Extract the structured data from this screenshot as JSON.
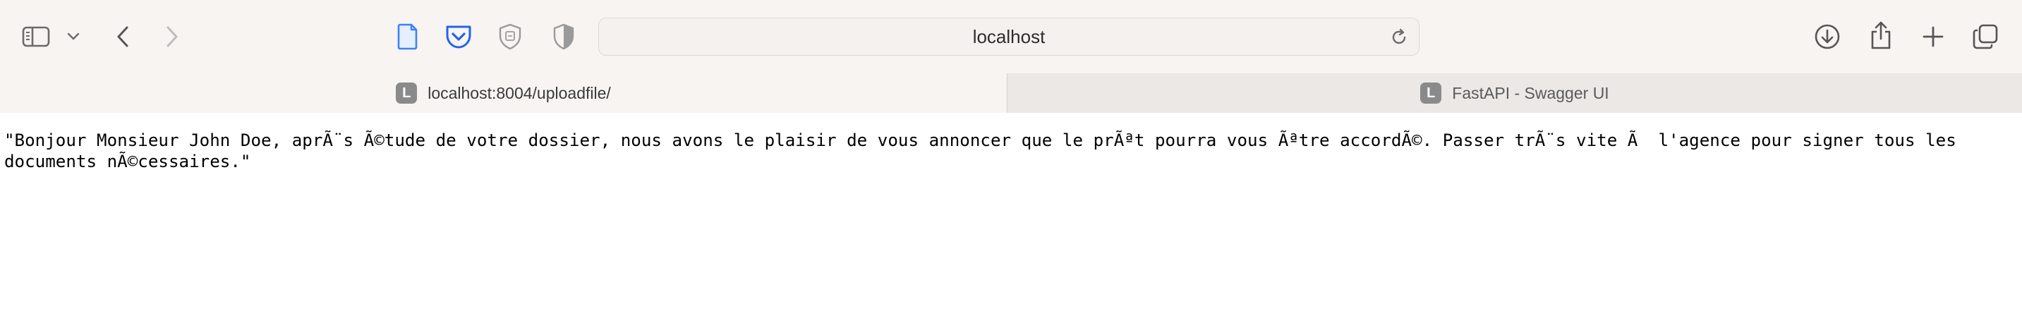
{
  "address_bar": {
    "url_display": "localhost"
  },
  "tabs": [
    {
      "favicon_letter": "L",
      "title": "localhost:8004/uploadfile/",
      "active": true
    },
    {
      "favicon_letter": "L",
      "title": "FastAPI - Swagger UI",
      "active": false
    }
  ],
  "content": {
    "text": "\"Bonjour Monsieur John Doe, aprÃ¨s Ã©tude de votre dossier, nous avons le plaisir de vous annoncer que le prÃªt pourra vous Ãªtre accordÃ©. Passer trÃ¨s vite Ã  l'agence pour signer tous les documents nÃ©cessaires.\""
  },
  "icons": {
    "sidebar": "sidebar-icon",
    "chevron": "chevron-down-icon",
    "back": "back-arrow-icon",
    "forward": "forward-arrow-icon",
    "reader": "reader-page-icon",
    "pocket": "pocket-icon",
    "privacy": "privacy-report-shield-icon",
    "extension": "half-shield-extension-icon",
    "reload": "reload-icon",
    "downloads": "download-icon",
    "share": "share-icon",
    "new_tab": "plus-icon",
    "tab_overview": "tab-overview-icon"
  },
  "colors": {
    "toolbar_bg": "#f7f4f2",
    "reader_blue": "#3b82f6",
    "pocket_blue": "#2563eb",
    "icon_gray": "#6b6b6b",
    "favicon_gray": "#8a8a8a"
  }
}
